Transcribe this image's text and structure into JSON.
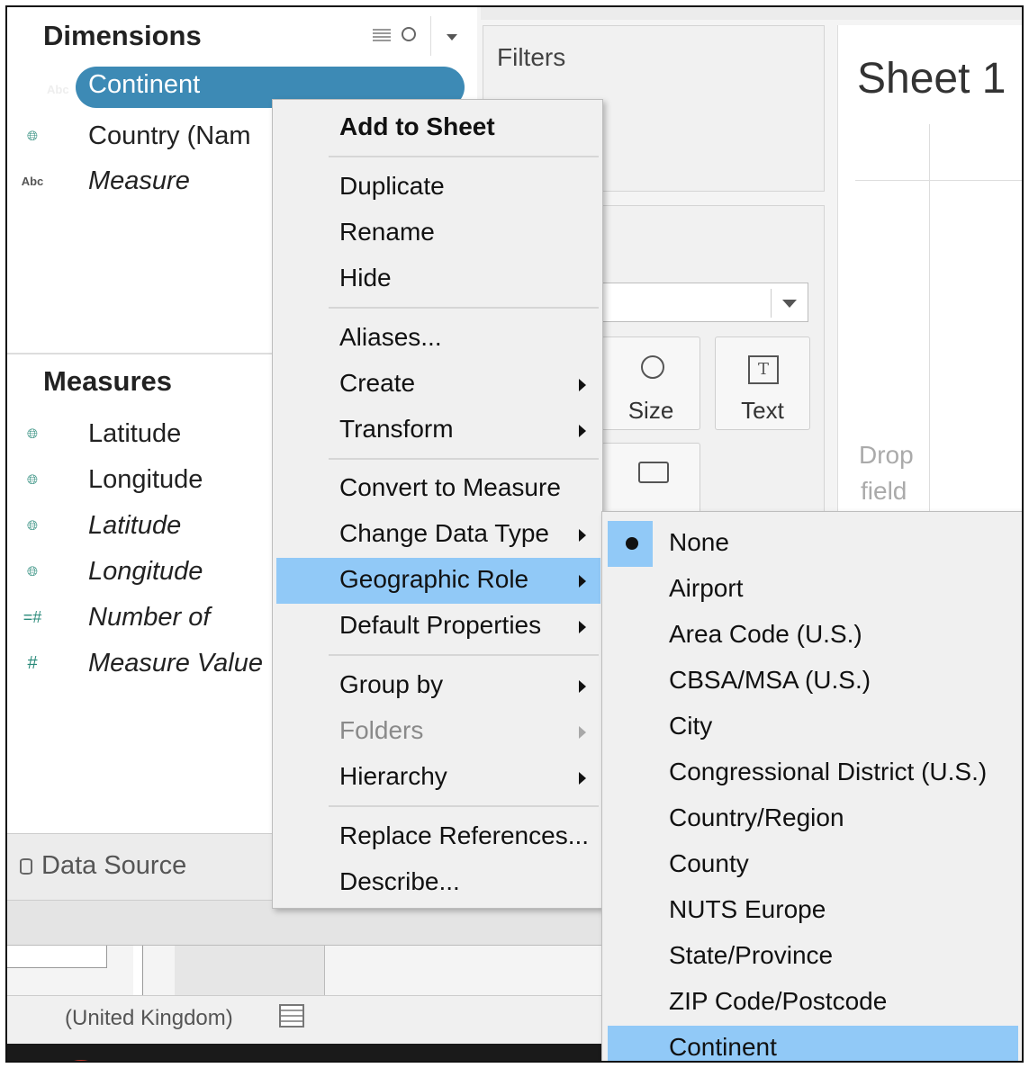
{
  "dimensions": {
    "title": "Dimensions",
    "fields": [
      {
        "icon": "Abc",
        "name": "Continent",
        "selected": true
      },
      {
        "icon": "globe",
        "name": "Country (Nam"
      },
      {
        "icon": "Abc",
        "name": "Measure",
        "italic": true
      }
    ]
  },
  "measures": {
    "title": "Measures",
    "fields": [
      {
        "icon": "globe",
        "name": "Latitude"
      },
      {
        "icon": "globe",
        "name": "Longitude"
      },
      {
        "icon": "globe",
        "name": "Latitude",
        "italic": true
      },
      {
        "icon": "globe",
        "name": "Longitude",
        "italic": true
      },
      {
        "icon": "=#",
        "name": "Number of",
        "italic": true
      },
      {
        "icon": "#",
        "name": "Measure Value",
        "italic": true
      }
    ]
  },
  "data_source": {
    "label": "Data Source"
  },
  "filters": {
    "label": "Filters"
  },
  "sheet": {
    "title": "Sheet 1"
  },
  "marks": {
    "size_label": "Size",
    "text_label": "Text"
  },
  "drop_hint": {
    "line1": "Drop",
    "line2": "field"
  },
  "status": {
    "label": "(United Kingdom)"
  },
  "context_menu": {
    "add_to_sheet": "Add to Sheet",
    "duplicate": "Duplicate",
    "rename": "Rename",
    "hide": "Hide",
    "aliases": "Aliases...",
    "create": "Create",
    "transform": "Transform",
    "convert_to_measure": "Convert to Measure",
    "change_data_type": "Change Data Type",
    "geographic_role": "Geographic Role",
    "default_properties": "Default Properties",
    "group_by": "Group by",
    "folders": "Folders",
    "hierarchy": "Hierarchy",
    "replace_references": "Replace References...",
    "describe": "Describe..."
  },
  "geo_submenu": {
    "items": [
      "None",
      "Airport",
      "Area Code (U.S.)",
      "CBSA/MSA (U.S.)",
      "City",
      "Congressional District (U.S.)",
      "Country/Region",
      "County",
      "NUTS Europe",
      "State/Province",
      "ZIP Code/Postcode",
      "Continent"
    ],
    "checked": "None",
    "highlighted": "Continent"
  },
  "colors": {
    "selection": "#3d8ab5",
    "menu_highlight": "#91c9f7"
  }
}
